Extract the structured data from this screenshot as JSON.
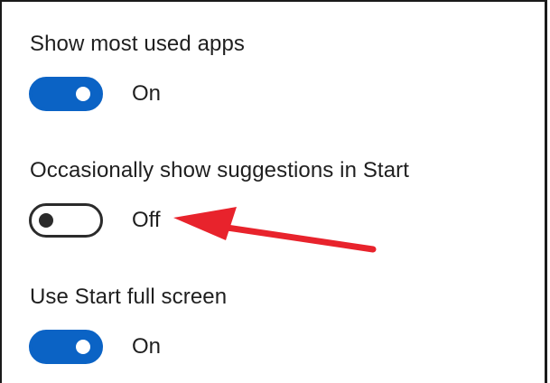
{
  "settings": [
    {
      "label": "Show most used apps",
      "state": "On"
    },
    {
      "label": "Occasionally show suggestions in Start",
      "state": "Off"
    },
    {
      "label": "Use Start full screen",
      "state": "On"
    }
  ],
  "colors": {
    "toggle_on": "#0b63c5",
    "toggle_off_outline": "#2b2b2b",
    "annotation_arrow": "#e8232c"
  }
}
